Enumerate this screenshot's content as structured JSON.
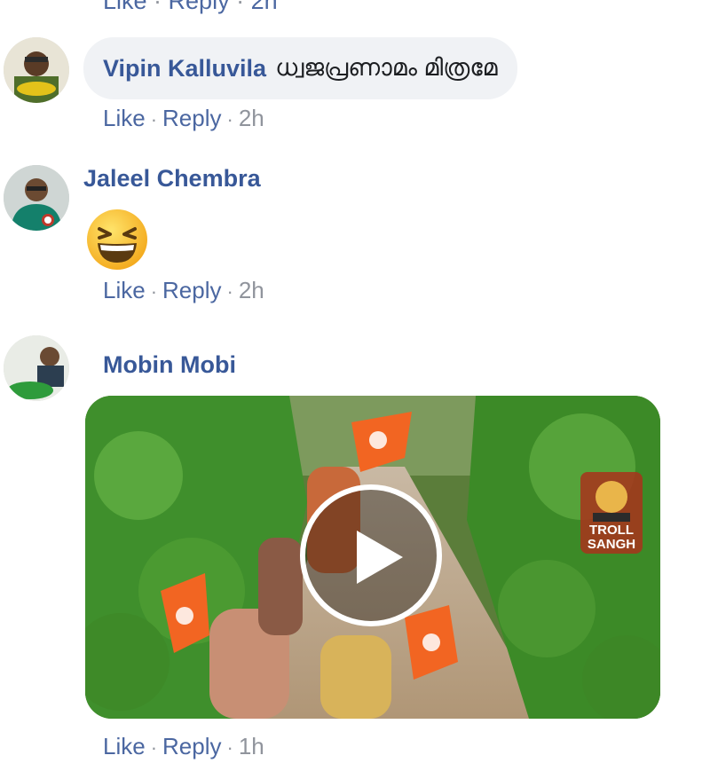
{
  "top_partial": {
    "like": "Like",
    "reply": "Reply",
    "time": "2h"
  },
  "comments": [
    {
      "author": "Vipin Kalluvila",
      "text": "ധ്വജപ്രണാമം മിത്രമേ",
      "actions": {
        "like": "Like",
        "reply": "Reply",
        "time": "2h"
      }
    },
    {
      "author": "Jaleel Chembra",
      "emoji": "grinning-squinting-face",
      "actions": {
        "like": "Like",
        "reply": "Reply",
        "time": "2h"
      }
    },
    {
      "author": "Mobin Mobi",
      "video": {
        "watermark_line1": "TROLL",
        "watermark_line2": "SANGH"
      },
      "actions": {
        "like": "Like",
        "reply": "Reply",
        "time": "1h"
      }
    }
  ],
  "colors": {
    "link": "#385898",
    "meta": "#90949c",
    "bubble": "#f0f2f5",
    "flag": "#f26522"
  }
}
